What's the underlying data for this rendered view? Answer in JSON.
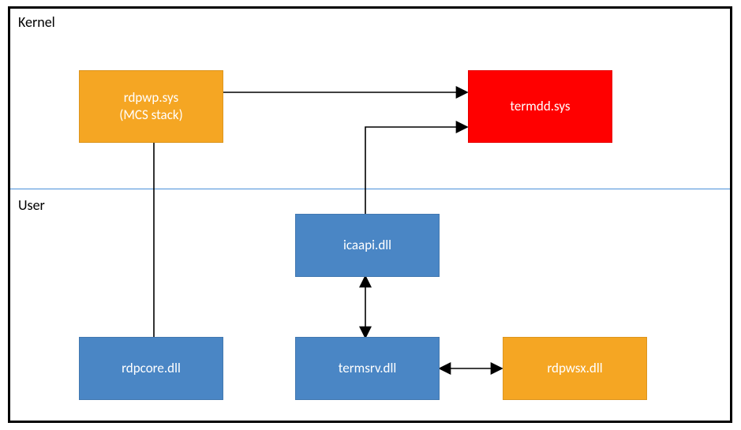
{
  "sections": {
    "kernel_label": "Kernel",
    "user_label": "User"
  },
  "nodes": {
    "rdpwp": {
      "label": "rdpwp.sys\n(MCS stack)",
      "color": "orange"
    },
    "termdd": {
      "label": "termdd.sys",
      "color": "red"
    },
    "icaapi": {
      "label": "icaapi.dll",
      "color": "blue"
    },
    "rdpcore": {
      "label": "rdpcore.dll",
      "color": "blue"
    },
    "termsrv": {
      "label": "termsrv.dll",
      "color": "blue"
    },
    "rdpwsx": {
      "label": "rdpwsx.dll",
      "color": "orange"
    }
  },
  "edges": [
    {
      "from": "rdpwp",
      "to": "termdd",
      "type": "arrow",
      "desc": "rdpwp.sys to termdd.sys"
    },
    {
      "from": "icaapi",
      "to": "termdd",
      "type": "arrow",
      "desc": "icaapi.dll to termdd.sys"
    },
    {
      "from": "rdpwp",
      "to": "rdpcore",
      "type": "line",
      "desc": "rdpwp.sys to rdpcore.dll"
    },
    {
      "from": "icaapi",
      "to": "termsrv",
      "type": "double",
      "desc": "icaapi.dll to/from termsrv.dll"
    },
    {
      "from": "termsrv",
      "to": "rdpwsx",
      "type": "double",
      "desc": "termsrv.dll to/from rdpwsx.dll"
    }
  ],
  "chart_data": {
    "type": "diagram",
    "title": "",
    "layers": [
      {
        "name": "Kernel",
        "nodes": [
          "rdpwp.sys (MCS stack)",
          "termdd.sys"
        ]
      },
      {
        "name": "User",
        "nodes": [
          "icaapi.dll",
          "rdpcore.dll",
          "termsrv.dll",
          "rdpwsx.dll"
        ]
      }
    ],
    "nodes": [
      {
        "id": "rdpwp",
        "label": "rdpwp.sys (MCS stack)",
        "layer": "Kernel",
        "color": "#f5a623"
      },
      {
        "id": "termdd",
        "label": "termdd.sys",
        "layer": "Kernel",
        "color": "#ff0000"
      },
      {
        "id": "icaapi",
        "label": "icaapi.dll",
        "layer": "User",
        "color": "#4a86c5"
      },
      {
        "id": "rdpcore",
        "label": "rdpcore.dll",
        "layer": "User",
        "color": "#4a86c5"
      },
      {
        "id": "termsrv",
        "label": "termsrv.dll",
        "layer": "User",
        "color": "#4a86c5"
      },
      {
        "id": "rdpwsx",
        "label": "rdpwsx.dll",
        "layer": "User",
        "color": "#f5a623"
      }
    ],
    "edges": [
      {
        "from": "rdpwp",
        "to": "termdd",
        "directed": true,
        "bidirectional": false
      },
      {
        "from": "icaapi",
        "to": "termdd",
        "directed": true,
        "bidirectional": false
      },
      {
        "from": "rdpwp",
        "to": "rdpcore",
        "directed": false,
        "bidirectional": false
      },
      {
        "from": "icaapi",
        "to": "termsrv",
        "directed": true,
        "bidirectional": true
      },
      {
        "from": "termsrv",
        "to": "rdpwsx",
        "directed": true,
        "bidirectional": true
      }
    ]
  }
}
